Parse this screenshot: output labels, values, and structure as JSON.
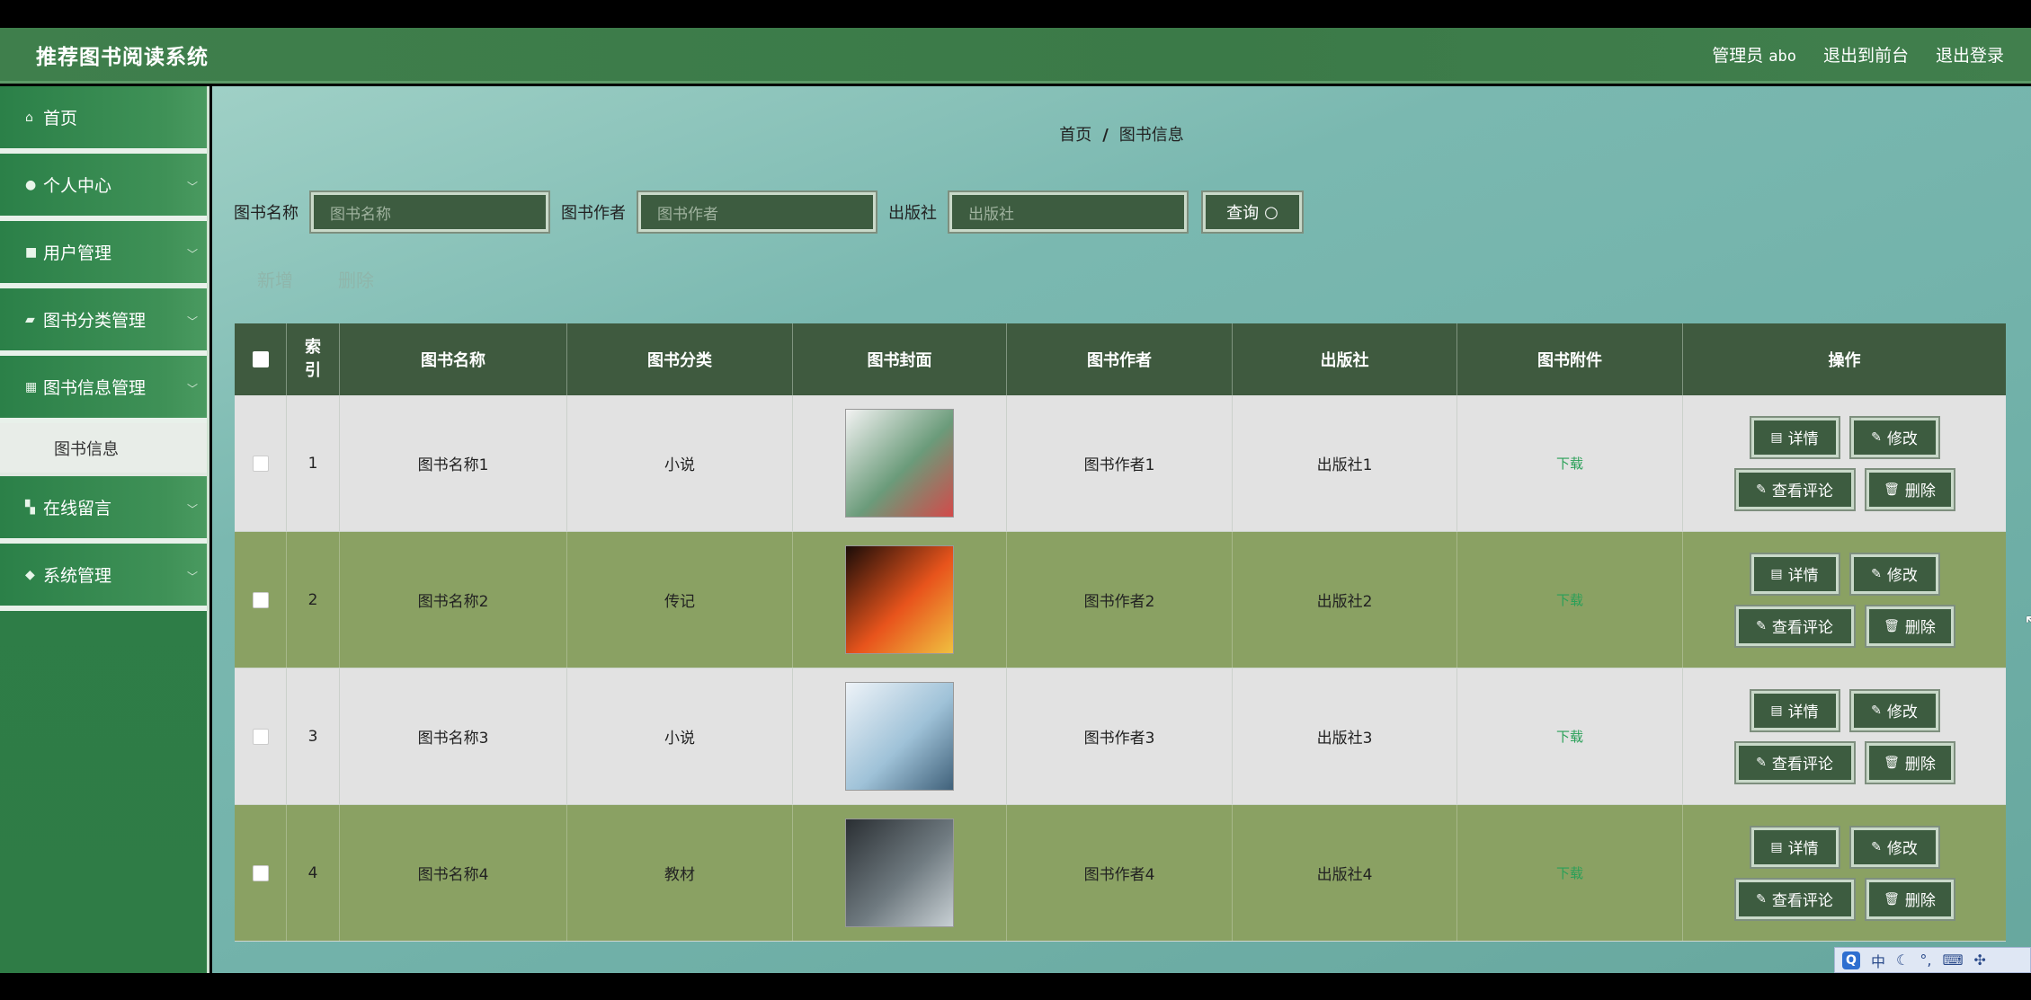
{
  "app": {
    "title": "推荐图书阅读系统",
    "role_label": "管理员",
    "user_name": "abo",
    "goto_front": "退出到前台",
    "logout": "退出登录"
  },
  "sidebar": {
    "items": [
      {
        "label": "首页",
        "icon": "home-icon",
        "has_children": false
      },
      {
        "label": "个人中心",
        "icon": "user-icon",
        "has_children": true
      },
      {
        "label": "用户管理",
        "icon": "briefcase-icon",
        "has_children": true
      },
      {
        "label": "图书分类管理",
        "icon": "folder-icon",
        "has_children": true
      },
      {
        "label": "图书信息管理",
        "icon": "grid-icon",
        "has_children": true
      },
      {
        "label": "在线留言",
        "icon": "apps-icon",
        "has_children": true
      },
      {
        "label": "系统管理",
        "icon": "shield-icon",
        "has_children": true
      }
    ],
    "active_sub": "图书信息"
  },
  "breadcrumb": {
    "home": "首页",
    "separator": "/",
    "current": "图书信息"
  },
  "search": {
    "name_label": "图书名称",
    "name_placeholder": "图书名称",
    "author_label": "图书作者",
    "author_placeholder": "图书作者",
    "publisher_label": "出版社",
    "publisher_placeholder": "出版社",
    "query_label": "查询"
  },
  "toolbar": {
    "add_label": "新增",
    "delete_label": "删除"
  },
  "table": {
    "headers": {
      "index": "索引",
      "name": "图书名称",
      "category": "图书分类",
      "cover": "图书封面",
      "author": "图书作者",
      "publisher": "出版社",
      "attachment": "图书附件",
      "operation": "操作"
    },
    "rows": [
      {
        "index": "1",
        "name": "图书名称1",
        "category": "小说",
        "author": "图书作者1",
        "publisher": "出版社1",
        "attachment": "下载",
        "cover_colors": [
          "#f2f2f2",
          "#6b9b7a",
          "#d34a4a"
        ]
      },
      {
        "index": "2",
        "name": "图书名称2",
        "category": "传记",
        "author": "图书作者2",
        "publisher": "出版社2",
        "attachment": "下载",
        "cover_colors": [
          "#1a0c08",
          "#e8541c",
          "#f0c040"
        ]
      },
      {
        "index": "3",
        "name": "图书名称3",
        "category": "小说",
        "author": "图书作者3",
        "publisher": "出版社3",
        "attachment": "下载",
        "cover_colors": [
          "#eef3f8",
          "#9fc2d8",
          "#40617a"
        ]
      },
      {
        "index": "4",
        "name": "图书名称4",
        "category": "教材",
        "author": "图书作者4",
        "publisher": "出版社4",
        "attachment": "下载",
        "cover_colors": [
          "#2a2f33",
          "#6f7a80",
          "#c8d0d4"
        ]
      }
    ],
    "row_buttons": {
      "detail": "详情",
      "edit": "修改",
      "comments": "查看评论",
      "delete": "删除"
    }
  },
  "ime": {
    "logo": "Q",
    "mode": "中"
  }
}
